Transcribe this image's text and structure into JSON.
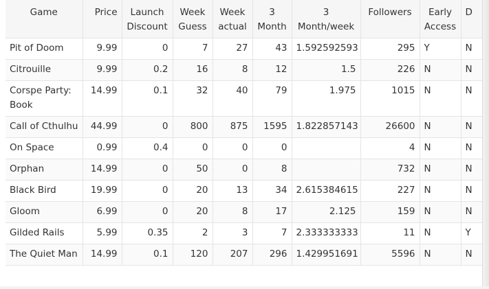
{
  "headers": {
    "game": "Game",
    "price": "Price",
    "launch_discount": "Launch Discount",
    "week_guess": "Week Guess",
    "week_actual": "Week actual",
    "three_month": "3 Month",
    "three_month_week": "3 Month/week",
    "followers": "Followers",
    "early_access": "Early Access",
    "d": "D"
  },
  "rows": [
    {
      "game": "Pit of Doom",
      "price": "9.99",
      "launch_discount": "0",
      "week_guess": "7",
      "week_actual": "27",
      "three_month": "43",
      "three_month_week": "1.592592593",
      "followers": "295",
      "early_access": "Y",
      "d": "N"
    },
    {
      "game": "Citrouille",
      "price": "9.99",
      "launch_discount": "0.2",
      "week_guess": "16",
      "week_actual": "8",
      "three_month": "12",
      "three_month_week": "1.5",
      "followers": "226",
      "early_access": "N",
      "d": "N"
    },
    {
      "game": "Corspe Party: Book",
      "price": "14.99",
      "launch_discount": "0.1",
      "week_guess": "32",
      "week_actual": "40",
      "three_month": "79",
      "three_month_week": "1.975",
      "followers": "1015",
      "early_access": "N",
      "d": "N"
    },
    {
      "game": "Call of Cthulhu",
      "price": "44.99",
      "launch_discount": "0",
      "week_guess": "800",
      "week_actual": "875",
      "three_month": "1595",
      "three_month_week": "1.822857143",
      "followers": "26600",
      "early_access": "N",
      "d": "N"
    },
    {
      "game": "On Space",
      "price": "0.99",
      "launch_discount": "0.4",
      "week_guess": "0",
      "week_actual": "0",
      "three_month": "0",
      "three_month_week": "",
      "followers": "4",
      "early_access": "N",
      "d": "N"
    },
    {
      "game": "Orphan",
      "price": "14.99",
      "launch_discount": "0",
      "week_guess": "50",
      "week_actual": "0",
      "three_month": "8",
      "three_month_week": "",
      "followers": "732",
      "early_access": "N",
      "d": "N"
    },
    {
      "game": "Black Bird",
      "price": "19.99",
      "launch_discount": "0",
      "week_guess": "20",
      "week_actual": "13",
      "three_month": "34",
      "three_month_week": "2.615384615",
      "followers": "227",
      "early_access": "N",
      "d": "N"
    },
    {
      "game": "Gloom",
      "price": "6.99",
      "launch_discount": "0",
      "week_guess": "20",
      "week_actual": "8",
      "three_month": "17",
      "three_month_week": "2.125",
      "followers": "159",
      "early_access": "N",
      "d": "N"
    },
    {
      "game": "Gilded Rails",
      "price": "5.99",
      "launch_discount": "0.35",
      "week_guess": "2",
      "week_actual": "3",
      "three_month": "7",
      "three_month_week": "2.333333333",
      "followers": "11",
      "early_access": "N",
      "d": "Y"
    },
    {
      "game": "The Quiet Man",
      "price": "14.99",
      "launch_discount": "0.1",
      "week_guess": "120",
      "week_actual": "207",
      "three_month": "296",
      "three_month_week": "1.429951691",
      "followers": "5596",
      "early_access": "N",
      "d": "N"
    }
  ]
}
